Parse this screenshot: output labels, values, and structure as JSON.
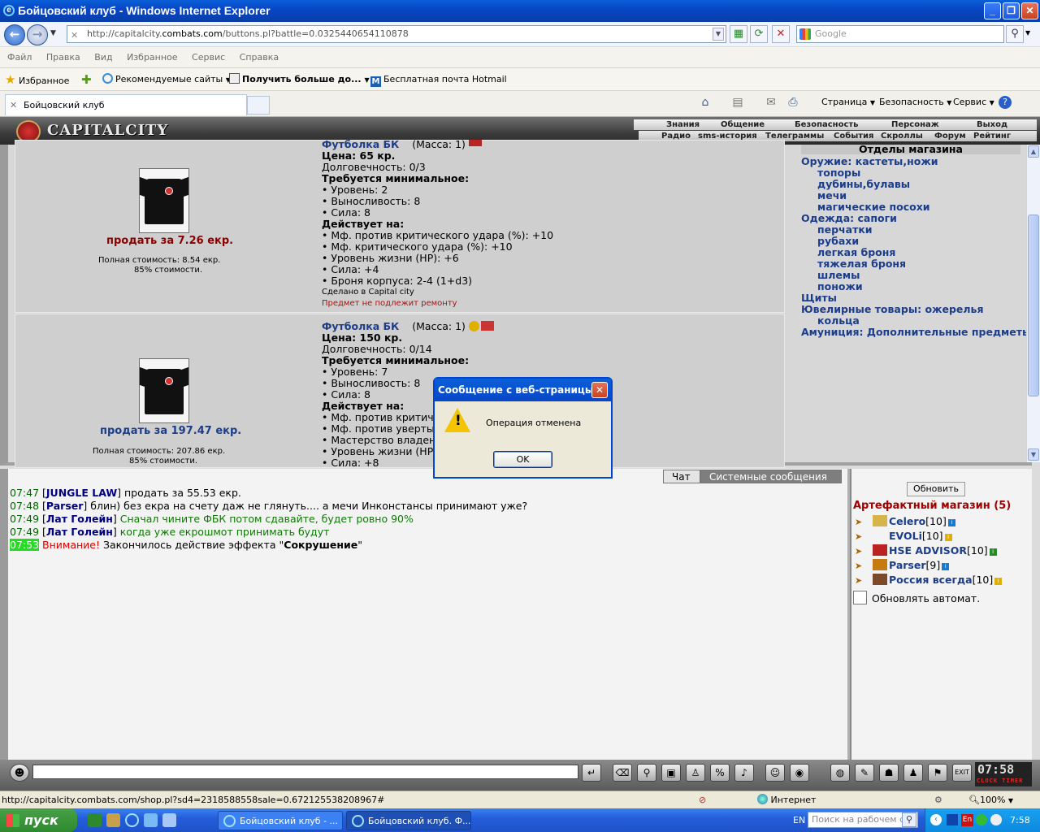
{
  "window": {
    "title": "Бойцовский клуб - Windows Internet Explorer"
  },
  "address": {
    "url_prefix": "http://capitalcity.",
    "url_domain": "combats.com",
    "url_path": "/buttons.pl?battle=0.0325440654110878"
  },
  "search": {
    "placeholder": "Google"
  },
  "menu": [
    "Файл",
    "Правка",
    "Вид",
    "Избранное",
    "Сервис",
    "Справка"
  ],
  "favorites": {
    "label": "Избранное",
    "items": [
      "Рекомендуемые сайты",
      "Получить больше до...",
      "Бесплатная почта Hotmail"
    ]
  },
  "tab": {
    "title": "Бойцовский клуб"
  },
  "commands": {
    "page": "Страница",
    "safety": "Безопасность",
    "service": "Сервис"
  },
  "game": {
    "logo": "CAPITALCITY",
    "nav_top": [
      "Знания",
      "Общение",
      "Безопасность",
      "Персонаж",
      "Выход"
    ],
    "nav_bottom": [
      "Радио",
      "sms-история",
      "Телеграммы",
      "События",
      "Скроллы",
      "Форум",
      "Рейтинг"
    ],
    "items": [
      {
        "sell": "продать за 7.26 екр.",
        "full_cost": "Полная стоимость: 8.54 екр.",
        "percent": "85% стоимости.",
        "name": "Футболка БК",
        "mass": "(Масса: 1)",
        "price": "Цена: 65 кр.",
        "durability": "Долговечность: 0/3",
        "req_header": "Требуется минимальное:",
        "reqs": [
          "• Уровень: 2",
          "• Выносливость: 8",
          "• Сила: 8"
        ],
        "eff_header": "Действует на:",
        "effects": [
          "• Мф. против критического удара (%): +10",
          "• Мф. критического удара (%): +10",
          "• Уровень жизни (HP): +6",
          "• Сила: +4",
          "• Броня корпуса: 2-4 (1+d3)"
        ],
        "made": "Сделано в Capital city",
        "norepair": "Предмет не подлежит ремонту"
      },
      {
        "sell": "продать за 197.47 екр.",
        "full_cost": "Полная стоимость: 207.86 екр.",
        "percent": "85% стоимости.",
        "name": "Футболка БК",
        "mass": "(Масса: 1)",
        "price": "Цена: 150 кр.",
        "durability": "Долговечность: 0/14",
        "req_header": "Требуется минимальное:",
        "reqs": [
          "• Уровень: 7",
          "• Выносливость: 8",
          "• Сила: 8"
        ],
        "eff_header": "Действует на:",
        "effects": [
          "• Мф. против критичес",
          "• Мф. против увертыва",
          "• Мастерство владения",
          "• Уровень жизни (HP):",
          "• Сила: +8"
        ]
      }
    ],
    "departments": {
      "title": "Отделы магазина",
      "entries": [
        {
          "text": "Оружие: кастеты,ножи",
          "sub": false
        },
        {
          "text": "топоры",
          "sub": true
        },
        {
          "text": "дубины,булавы",
          "sub": true
        },
        {
          "text": "мечи",
          "sub": true
        },
        {
          "text": "магические посохи",
          "sub": true
        },
        {
          "text": "Одежда: сапоги",
          "sub": false
        },
        {
          "text": "перчатки",
          "sub": true
        },
        {
          "text": "рубахи",
          "sub": true
        },
        {
          "text": "легкая броня",
          "sub": true
        },
        {
          "text": "тяжелая броня",
          "sub": true
        },
        {
          "text": "шлемы",
          "sub": true
        },
        {
          "text": "поножи",
          "sub": true
        },
        {
          "text": "Щиты",
          "sub": false
        },
        {
          "text": "Ювелирные товары: ожерелья",
          "sub": false
        },
        {
          "text": "кольца",
          "sub": true
        },
        {
          "text": "Амуниция: Дополнительные предметы",
          "sub": false
        }
      ]
    },
    "chat_tabs": {
      "chat": "Чат",
      "system": "Системные сообщения"
    },
    "chat": [
      {
        "time": "07:47",
        "nick": "JUNGLE LAW",
        "text": " продать за 55.53 екр.",
        "style": "normal"
      },
      {
        "time": "07:48",
        "nick": "Parser",
        "text": " блин) без екра на счету даж не глянуть.... а мечи Инконстансы принимают уже?",
        "style": "normal"
      },
      {
        "time": "07:49",
        "nick": "Лат Голейн",
        "text": " Сначал чините ФБК потом сдавайте, будет ровно 90%",
        "style": "green"
      },
      {
        "time": "07:49",
        "nick": "Лат Голейн",
        "text": " когда уже екрошмот принимать будут",
        "style": "green"
      }
    ],
    "system_line": {
      "time": "07:53",
      "warning": "Внимание!",
      "text": " Закончилось действие эффекта \"",
      "effect": "Сокрушение",
      "end": "\""
    },
    "online": {
      "refresh": "Обновить",
      "title": "Артефактный магазин (5)",
      "users": [
        {
          "name": "Celero",
          "level": "[10]"
        },
        {
          "name": "EVOLi",
          "level": "[10]"
        },
        {
          "name": "HSE ADVISOR",
          "level": "[10]"
        },
        {
          "name": "Parser",
          "level": "[9]"
        },
        {
          "name": "Россия всегда",
          "level": "[10]"
        }
      ],
      "auto": "Обновлять автомат."
    },
    "clock": {
      "time": "07:58",
      "label": "CLOCK TIMER"
    }
  },
  "dialog": {
    "title": "Сообщение с веб-страницы",
    "message": "Операция отменена",
    "ok": "OK"
  },
  "status": {
    "url": "http://capitalcity.combats.com/shop.pl?sd4=2318588558sale=0.672125538208967#",
    "zone": "Интернет",
    "zoom": "100%"
  },
  "taskbar": {
    "start": "пуск",
    "tasks": [
      "Бойцовский клуб - ...",
      "Бойцовский клуб. Ф..."
    ],
    "lang": "EN",
    "search_placeholder": "Поиск на рабочем ст",
    "time": "7:58"
  }
}
